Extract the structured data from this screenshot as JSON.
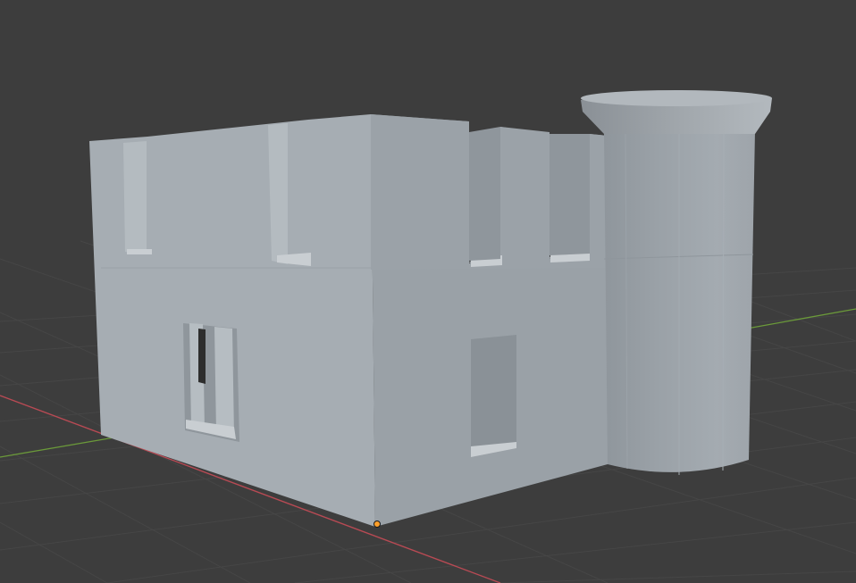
{
  "viewport": {
    "background_color": "#3d3d3d",
    "grid_color": "#4a4a4a",
    "x_axis_color": "#b84a54",
    "y_axis_color": "#6b9a3a",
    "selection_color": "#ff9f2a"
  },
  "scene": {
    "object": "castle-building-mesh",
    "shading": "solid",
    "origin_marker": "origin-dot-icon"
  }
}
